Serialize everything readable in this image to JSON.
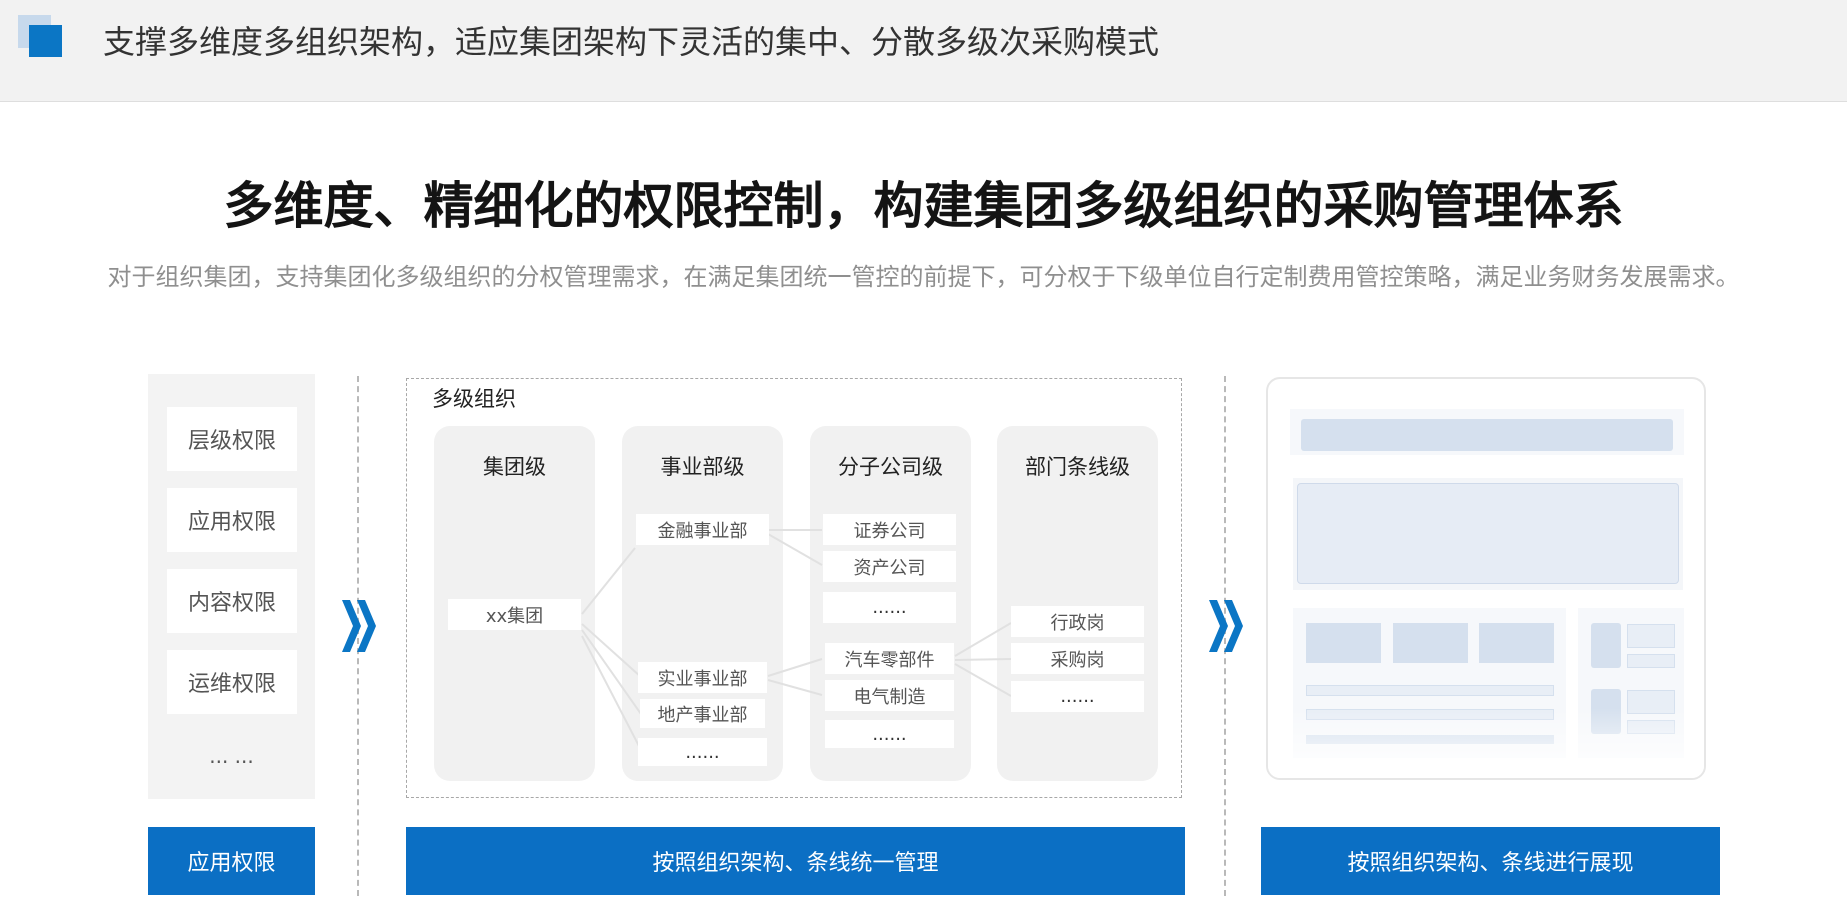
{
  "header": {
    "title": "支撑多维度多组织架构，适应集团架构下灵活的集中、分散多级次采购模式"
  },
  "main": {
    "title": "多维度、精细化的权限控制，构建集团多级组织的采购管理体系",
    "subtitle": "对于组织集团，支持集团化多级组织的分权管理需求，在满足集团统一管控的前提下，可分权于下级单位自行定制费用管控策略，满足业务财务发展需求。"
  },
  "permissions": {
    "items": [
      "层级权限",
      "应用权限",
      "内容权限",
      "运维权限"
    ],
    "more": "... ..."
  },
  "org": {
    "label": "多级组织",
    "levels": [
      "集团级",
      "事业部级",
      "分子公司级",
      "部门条线级"
    ],
    "group": [
      "xx集团"
    ],
    "divisions": [
      "金融事业部",
      "实业事业部",
      "地产事业部",
      "......"
    ],
    "companies": [
      "证券公司",
      "资产公司",
      "......",
      "汽车零部件",
      "电气制造",
      "......"
    ],
    "departments": [
      "行政岗",
      "采购岗",
      "......"
    ]
  },
  "colors": {
    "accent": "#0b6fc4",
    "mock_block": "#d5e0ee",
    "panel": "#f3f3f3"
  },
  "bottom": {
    "left": "应用权限",
    "middle": "按照组织架构、条线统一管理",
    "right": "按照组织架构、条线进行展现"
  }
}
